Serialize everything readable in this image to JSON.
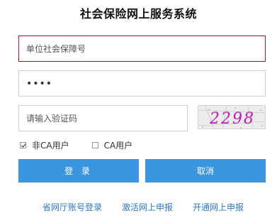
{
  "header": {
    "title": "社会保险网上服务系统"
  },
  "form": {
    "unit_placeholder": "单位社会保障号",
    "password_value": "••••",
    "captcha_placeholder": "请输入验证码",
    "captcha_text": "2298"
  },
  "login_type": {
    "options": [
      {
        "label": "非CA用户",
        "checked": true
      },
      {
        "label": "CA用户",
        "checked": false
      }
    ]
  },
  "buttons": {
    "login": "登 录",
    "cancel": "取消"
  },
  "links": [
    "省网厅账号登录",
    "激活网上申报",
    "开通网上申报"
  ],
  "colors": {
    "button_bg": "#3c96df",
    "link": "#2f78c4",
    "active_border": "#b0122c",
    "captcha_text": "#c21bb8"
  }
}
